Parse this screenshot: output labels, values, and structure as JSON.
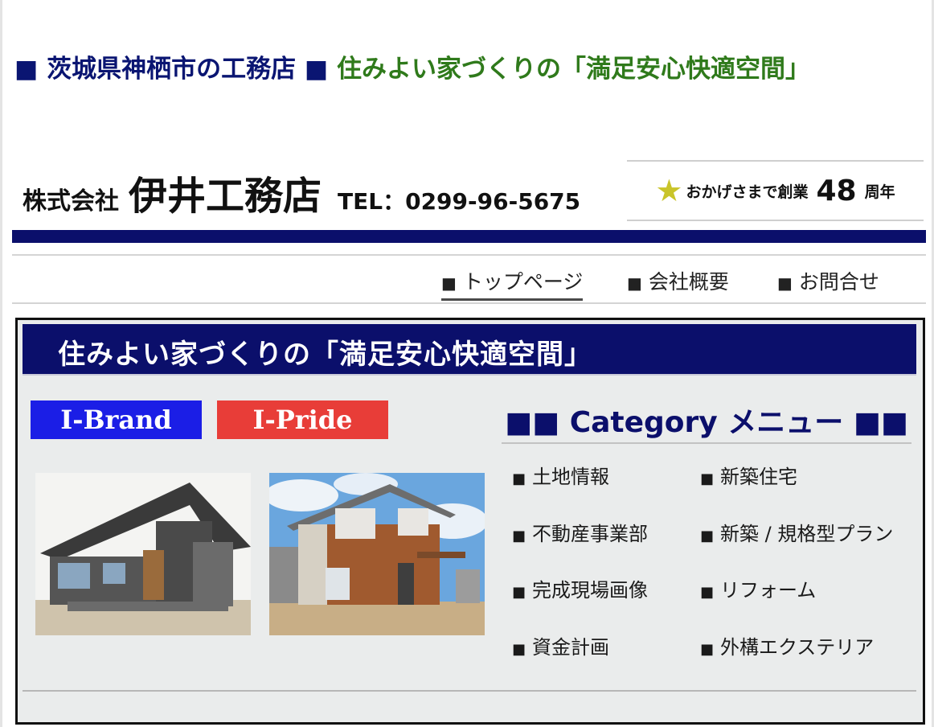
{
  "hero": {
    "prefix": "■ 茨城県神栖市の工務店 ■",
    "title": "住みよい家づくりの「満足安心快適空間」"
  },
  "company": {
    "prefix": "株式会社",
    "name": "伊井工務店",
    "tel": "TEL：0299-96-5675"
  },
  "anniversary": {
    "icon": "star-icon",
    "text": "おかげさまで創業",
    "years": "48",
    "unit": "周年"
  },
  "colors": {
    "navy": "#0b0f6b",
    "green": "#2f7a1b",
    "brand_blue": "#1b1ee6",
    "pride_red": "#e83d38",
    "panel_bg": "#eaecec",
    "star": "#c9c42a"
  },
  "nav": {
    "items": [
      {
        "marker": "■",
        "label": "トップページ",
        "active": true
      },
      {
        "marker": "■",
        "label": "会社概要",
        "active": false
      },
      {
        "marker": "■",
        "label": "お問合せ",
        "active": false
      }
    ]
  },
  "main": {
    "banner": "住みよい家づくりの「満足安心快適空間」",
    "brands": [
      {
        "label": "I-Brand"
      },
      {
        "label": "I-Pride"
      }
    ],
    "category_header": "■■  Category  メニュー ■■",
    "categories": [
      {
        "marker": "■",
        "label": "土地情報"
      },
      {
        "marker": "■",
        "label": "新築住宅"
      },
      {
        "marker": "■",
        "label": "不動産事業部"
      },
      {
        "marker": "■",
        "label": "新築 / 規格型プラン"
      },
      {
        "marker": "■",
        "label": "完成現場画像"
      },
      {
        "marker": "■",
        "label": "リフォーム"
      },
      {
        "marker": "■",
        "label": "資金計画"
      },
      {
        "marker": "■",
        "label": "外構エクステリア"
      }
    ]
  }
}
